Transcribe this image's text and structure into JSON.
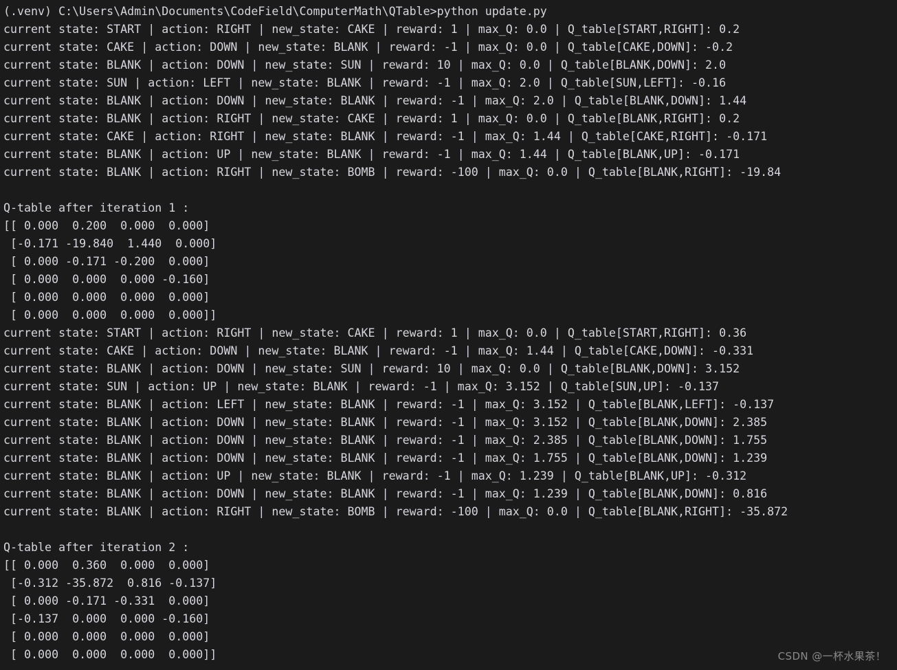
{
  "terminal": {
    "background_color": "#1b1b1b",
    "foreground_color": "#d6d6de",
    "watermark": "CSDN @一杯水果茶！",
    "prompt_line": "(.venv) C:\\Users\\Admin\\Documents\\CodeField\\ComputerMath\\QTable>python update.py",
    "lines": [
      "(.venv) C:\\Users\\Admin\\Documents\\CodeField\\ComputerMath\\QTable>python update.py",
      "current state: START | action: RIGHT | new_state: CAKE | reward: 1 | max_Q: 0.0 | Q_table[START,RIGHT]: 0.2",
      "current state: CAKE | action: DOWN | new_state: BLANK | reward: -1 | max_Q: 0.0 | Q_table[CAKE,DOWN]: -0.2",
      "current state: BLANK | action: DOWN | new_state: SUN | reward: 10 | max_Q: 0.0 | Q_table[BLANK,DOWN]: 2.0",
      "current state: SUN | action: LEFT | new_state: BLANK | reward: -1 | max_Q: 2.0 | Q_table[SUN,LEFT]: -0.16",
      "current state: BLANK | action: DOWN | new_state: BLANK | reward: -1 | max_Q: 2.0 | Q_table[BLANK,DOWN]: 1.44",
      "current state: BLANK | action: RIGHT | new_state: CAKE | reward: 1 | max_Q: 0.0 | Q_table[BLANK,RIGHT]: 0.2",
      "current state: CAKE | action: RIGHT | new_state: BLANK | reward: -1 | max_Q: 1.44 | Q_table[CAKE,RIGHT]: -0.171",
      "current state: BLANK | action: UP | new_state: BLANK | reward: -1 | max_Q: 1.44 | Q_table[BLANK,UP]: -0.171",
      "current state: BLANK | action: RIGHT | new_state: BOMB | reward: -100 | max_Q: 0.0 | Q_table[BLANK,RIGHT]: -19.84",
      "",
      "Q-table after iteration 1 :",
      "[[ 0.000  0.200  0.000  0.000]",
      " [-0.171 -19.840  1.440  0.000]",
      " [ 0.000 -0.171 -0.200  0.000]",
      " [ 0.000  0.000  0.000 -0.160]",
      " [ 0.000  0.000  0.000  0.000]",
      " [ 0.000  0.000  0.000  0.000]]",
      "current state: START | action: RIGHT | new_state: CAKE | reward: 1 | max_Q: 0.0 | Q_table[START,RIGHT]: 0.36",
      "current state: CAKE | action: DOWN | new_state: BLANK | reward: -1 | max_Q: 1.44 | Q_table[CAKE,DOWN]: -0.331",
      "current state: BLANK | action: DOWN | new_state: SUN | reward: 10 | max_Q: 0.0 | Q_table[BLANK,DOWN]: 3.152",
      "current state: SUN | action: UP | new_state: BLANK | reward: -1 | max_Q: 3.152 | Q_table[SUN,UP]: -0.137",
      "current state: BLANK | action: LEFT | new_state: BLANK | reward: -1 | max_Q: 3.152 | Q_table[BLANK,LEFT]: -0.137",
      "current state: BLANK | action: DOWN | new_state: BLANK | reward: -1 | max_Q: 3.152 | Q_table[BLANK,DOWN]: 2.385",
      "current state: BLANK | action: DOWN | new_state: BLANK | reward: -1 | max_Q: 2.385 | Q_table[BLANK,DOWN]: 1.755",
      "current state: BLANK | action: DOWN | new_state: BLANK | reward: -1 | max_Q: 1.755 | Q_table[BLANK,DOWN]: 1.239",
      "current state: BLANK | action: UP | new_state: BLANK | reward: -1 | max_Q: 1.239 | Q_table[BLANK,UP]: -0.312",
      "current state: BLANK | action: DOWN | new_state: BLANK | reward: -1 | max_Q: 1.239 | Q_table[BLANK,DOWN]: 0.816",
      "current state: BLANK | action: RIGHT | new_state: BOMB | reward: -100 | max_Q: 0.0 | Q_table[BLANK,RIGHT]: -35.872",
      "",
      "Q-table after iteration 2 :",
      "[[ 0.000  0.360  0.000  0.000]",
      " [-0.312 -35.872  0.816 -0.137]",
      " [ 0.000 -0.171 -0.331  0.000]",
      " [-0.137  0.000  0.000 -0.160]",
      " [ 0.000  0.000  0.000  0.000]",
      " [ 0.000  0.000  0.000  0.000]]"
    ],
    "iterations": [
      {
        "label": "Q-table after iteration 1 :",
        "steps": [
          {
            "current_state": "START",
            "action": "RIGHT",
            "new_state": "CAKE",
            "reward": 1,
            "max_Q": 0.0,
            "q_key": "Q_table[START,RIGHT]",
            "q_value": 0.2
          },
          {
            "current_state": "CAKE",
            "action": "DOWN",
            "new_state": "BLANK",
            "reward": -1,
            "max_Q": 0.0,
            "q_key": "Q_table[CAKE,DOWN]",
            "q_value": -0.2
          },
          {
            "current_state": "BLANK",
            "action": "DOWN",
            "new_state": "SUN",
            "reward": 10,
            "max_Q": 0.0,
            "q_key": "Q_table[BLANK,DOWN]",
            "q_value": 2.0
          },
          {
            "current_state": "SUN",
            "action": "LEFT",
            "new_state": "BLANK",
            "reward": -1,
            "max_Q": 2.0,
            "q_key": "Q_table[SUN,LEFT]",
            "q_value": -0.16
          },
          {
            "current_state": "BLANK",
            "action": "DOWN",
            "new_state": "BLANK",
            "reward": -1,
            "max_Q": 2.0,
            "q_key": "Q_table[BLANK,DOWN]",
            "q_value": 1.44
          },
          {
            "current_state": "BLANK",
            "action": "RIGHT",
            "new_state": "CAKE",
            "reward": 1,
            "max_Q": 0.0,
            "q_key": "Q_table[BLANK,RIGHT]",
            "q_value": 0.2
          },
          {
            "current_state": "CAKE",
            "action": "RIGHT",
            "new_state": "BLANK",
            "reward": -1,
            "max_Q": 1.44,
            "q_key": "Q_table[CAKE,RIGHT]",
            "q_value": -0.171
          },
          {
            "current_state": "BLANK",
            "action": "UP",
            "new_state": "BLANK",
            "reward": -1,
            "max_Q": 1.44,
            "q_key": "Q_table[BLANK,UP]",
            "q_value": -0.171
          },
          {
            "current_state": "BLANK",
            "action": "RIGHT",
            "new_state": "BOMB",
            "reward": -100,
            "max_Q": 0.0,
            "q_key": "Q_table[BLANK,RIGHT]",
            "q_value": -19.84
          }
        ],
        "q_table": [
          [
            0.0,
            0.2,
            0.0,
            0.0
          ],
          [
            -0.171,
            -19.84,
            1.44,
            0.0
          ],
          [
            0.0,
            -0.171,
            -0.2,
            0.0
          ],
          [
            0.0,
            0.0,
            0.0,
            -0.16
          ],
          [
            0.0,
            0.0,
            0.0,
            0.0
          ],
          [
            0.0,
            0.0,
            0.0,
            0.0
          ]
        ]
      },
      {
        "label": "Q-table after iteration 2 :",
        "steps": [
          {
            "current_state": "START",
            "action": "RIGHT",
            "new_state": "CAKE",
            "reward": 1,
            "max_Q": 0.0,
            "q_key": "Q_table[START,RIGHT]",
            "q_value": 0.36
          },
          {
            "current_state": "CAKE",
            "action": "DOWN",
            "new_state": "BLANK",
            "reward": -1,
            "max_Q": 1.44,
            "q_key": "Q_table[CAKE,DOWN]",
            "q_value": -0.331
          },
          {
            "current_state": "BLANK",
            "action": "DOWN",
            "new_state": "SUN",
            "reward": 10,
            "max_Q": 0.0,
            "q_key": "Q_table[BLANK,DOWN]",
            "q_value": 3.152
          },
          {
            "current_state": "SUN",
            "action": "UP",
            "new_state": "BLANK",
            "reward": -1,
            "max_Q": 3.152,
            "q_key": "Q_table[SUN,UP]",
            "q_value": -0.137
          },
          {
            "current_state": "BLANK",
            "action": "LEFT",
            "new_state": "BLANK",
            "reward": -1,
            "max_Q": 3.152,
            "q_key": "Q_table[BLANK,LEFT]",
            "q_value": -0.137
          },
          {
            "current_state": "BLANK",
            "action": "DOWN",
            "new_state": "BLANK",
            "reward": -1,
            "max_Q": 3.152,
            "q_key": "Q_table[BLANK,DOWN]",
            "q_value": 2.385
          },
          {
            "current_state": "BLANK",
            "action": "DOWN",
            "new_state": "BLANK",
            "reward": -1,
            "max_Q": 2.385,
            "q_key": "Q_table[BLANK,DOWN]",
            "q_value": 1.755
          },
          {
            "current_state": "BLANK",
            "action": "DOWN",
            "new_state": "BLANK",
            "reward": -1,
            "max_Q": 1.755,
            "q_key": "Q_table[BLANK,DOWN]",
            "q_value": 1.239
          },
          {
            "current_state": "BLANK",
            "action": "UP",
            "new_state": "BLANK",
            "reward": -1,
            "max_Q": 1.239,
            "q_key": "Q_table[BLANK,UP]",
            "q_value": -0.312
          },
          {
            "current_state": "BLANK",
            "action": "DOWN",
            "new_state": "BLANK",
            "reward": -1,
            "max_Q": 1.239,
            "q_key": "Q_table[BLANK,DOWN]",
            "q_value": 0.816
          },
          {
            "current_state": "BLANK",
            "action": "RIGHT",
            "new_state": "BOMB",
            "reward": -100,
            "max_Q": 0.0,
            "q_key": "Q_table[BLANK,RIGHT]",
            "q_value": -35.872
          }
        ],
        "q_table": [
          [
            0.0,
            0.36,
            0.0,
            0.0
          ],
          [
            -0.312,
            -35.872,
            0.816,
            -0.137
          ],
          [
            0.0,
            -0.171,
            -0.331,
            0.0
          ],
          [
            -0.137,
            0.0,
            0.0,
            -0.16
          ],
          [
            0.0,
            0.0,
            0.0,
            0.0
          ],
          [
            0.0,
            0.0,
            0.0,
            0.0
          ]
        ]
      }
    ]
  }
}
